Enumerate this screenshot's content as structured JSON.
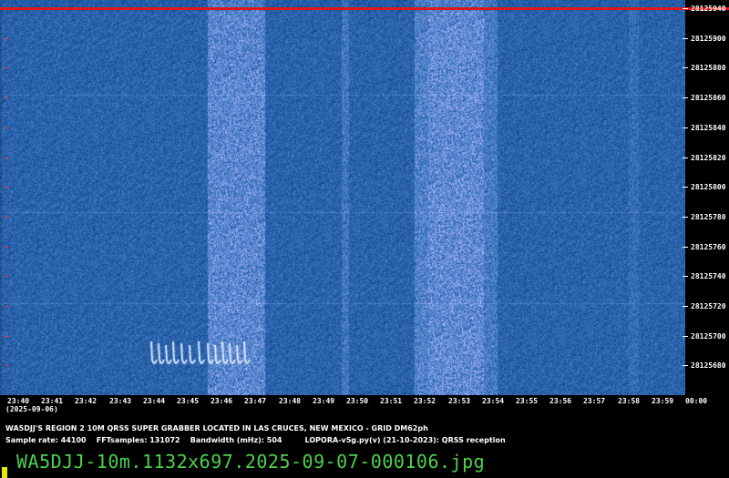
{
  "frequency_labels": [
    "28125940",
    "28125900",
    "28125880",
    "28125860",
    "28125840",
    "28125820",
    "28125800",
    "28125780",
    "28125760",
    "28125740",
    "28125720",
    "28125700",
    "28125680"
  ],
  "time_labels": [
    "23:40",
    "23:41",
    "23:42",
    "23:43",
    "23:44",
    "23:45",
    "23:46",
    "23:47",
    "23:48",
    "23:49",
    "23:50",
    "23:51",
    "23:52",
    "23:53",
    "23:54",
    "23:55",
    "23:56",
    "23:57",
    "23:58",
    "23:59",
    "00:00"
  ],
  "date_label": "(2025-09-06)",
  "description": "WA5DJJ'S REGION 2 10M QRSS SUPER GRABBER LOCATED IN LAS CRUCES, NEW MEXICO - GRID DM62ph",
  "params_line": "Sample rate: 44100    FFTsamples: 131072    Bandwidth (mHz): 504         LOPORA-v5g.py(v) (21-10-2023): QRSS reception",
  "filename": "WA5DJJ-10m.1132x697.2025-09-07-000106.jpg",
  "colors": {
    "background": "#0b2a6e",
    "red_line": "#e01818",
    "filename": "#4cd24c",
    "cursor": "#e8e800"
  }
}
